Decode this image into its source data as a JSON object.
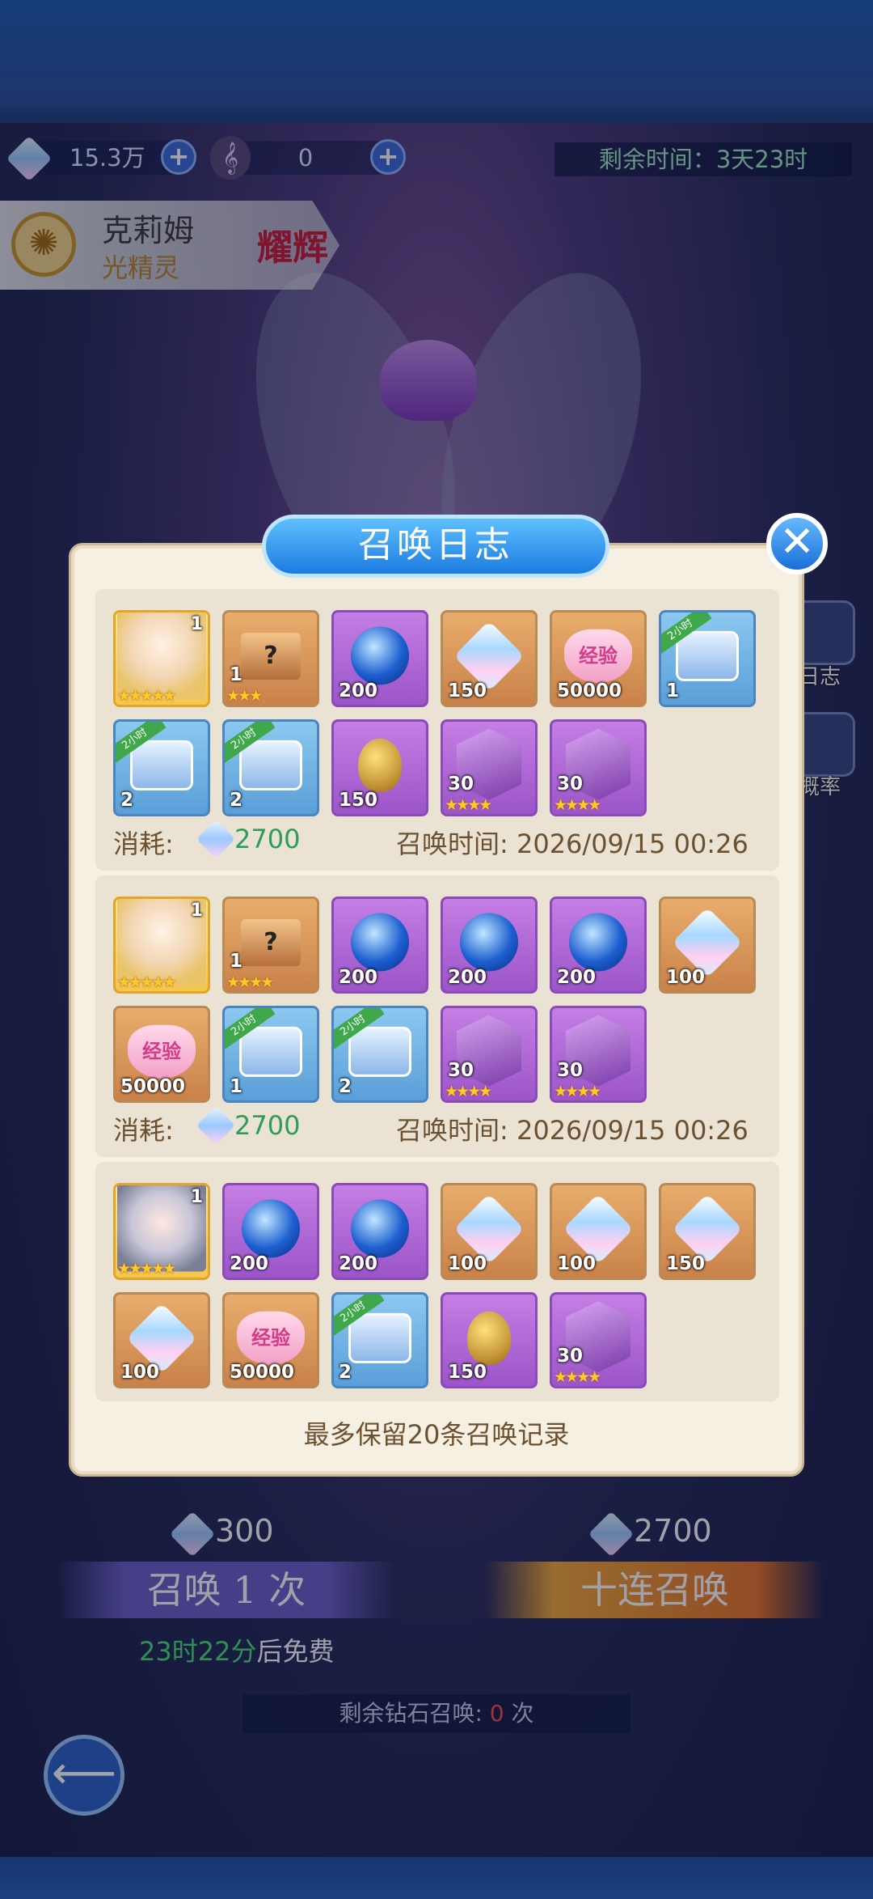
{
  "header": {
    "diamonds": "15.3万",
    "tickets": "0",
    "time_remaining": "剩余时间：3天23时"
  },
  "hero": {
    "name": "克莉姆",
    "title": "光精灵",
    "badge": "耀辉"
  },
  "side": {
    "log_label": "日志",
    "rate_label": "概率"
  },
  "modal": {
    "title": "召唤日志",
    "footer_note": "最多保留20条召唤记录",
    "records": [
      {
        "cost_label": "消耗:",
        "cost": "2700",
        "time_label": "召唤时间:",
        "time": "2026/09/15 00:26",
        "items": [
          {
            "kind": "hero-elf",
            "qty": "1",
            "stars": "★★★★★"
          },
          {
            "kind": "mystery-box",
            "qty": "1",
            "stars": "★★★"
          },
          {
            "kind": "orb",
            "qty": "200"
          },
          {
            "kind": "gem",
            "qty": "150"
          },
          {
            "kind": "exp-heart",
            "qty": "50000",
            "text": "经验"
          },
          {
            "kind": "chest",
            "qty": "1",
            "ribbon": "2小时"
          },
          {
            "kind": "chest-gold",
            "qty": "2",
            "ribbon": "2小时"
          },
          {
            "kind": "chest-gold",
            "qty": "2",
            "ribbon": "2小时"
          },
          {
            "kind": "egg",
            "qty": "150"
          },
          {
            "kind": "cube",
            "qty": "30",
            "stars": "★★★★"
          },
          {
            "kind": "cube",
            "qty": "30",
            "stars": "★★★★"
          }
        ]
      },
      {
        "cost_label": "消耗:",
        "cost": "2700",
        "time_label": "召唤时间:",
        "time": "2026/09/15 00:26",
        "items": [
          {
            "kind": "hero-elf",
            "qty": "1",
            "stars": "★★★★★"
          },
          {
            "kind": "mystery-box",
            "qty": "1",
            "stars": "★★★★"
          },
          {
            "kind": "orb",
            "qty": "200"
          },
          {
            "kind": "orb",
            "qty": "200"
          },
          {
            "kind": "orb",
            "qty": "200"
          },
          {
            "kind": "gem",
            "qty": "100"
          },
          {
            "kind": "exp-heart",
            "qty": "50000",
            "text": "经验"
          },
          {
            "kind": "chest",
            "qty": "1",
            "ribbon": "2小时"
          },
          {
            "kind": "chest-gold",
            "qty": "2",
            "ribbon": "2小时"
          },
          {
            "kind": "cube",
            "qty": "30",
            "stars": "★★★★"
          },
          {
            "kind": "cube",
            "qty": "30",
            "stars": "★★★★"
          }
        ]
      },
      {
        "items": [
          {
            "kind": "hero-girl",
            "qty": "1",
            "stars": "★★★★★"
          },
          {
            "kind": "orb",
            "qty": "200"
          },
          {
            "kind": "orb",
            "qty": "200"
          },
          {
            "kind": "gem",
            "qty": "100"
          },
          {
            "kind": "gem",
            "qty": "100"
          },
          {
            "kind": "gem",
            "qty": "150"
          },
          {
            "kind": "gem",
            "qty": "100"
          },
          {
            "kind": "exp-heart",
            "qty": "50000",
            "text": "经验"
          },
          {
            "kind": "chest-gold",
            "qty": "2",
            "ribbon": "2小时"
          },
          {
            "kind": "egg",
            "qty": "150"
          },
          {
            "kind": "cube",
            "qty": "30",
            "stars": "★★★★"
          }
        ]
      }
    ]
  },
  "summon": {
    "single_cost": "300",
    "ten_cost": "2700",
    "single_label": "召唤 1 次",
    "ten_label": "十连召唤",
    "free_time": "23时22分",
    "free_suffix": "后免费",
    "remaining_label": "剩余钻石召唤:",
    "remaining_count": "0",
    "remaining_unit": "次"
  },
  "colors": {
    "modal_bg": "#f6f0e3",
    "accent_blue": "#1c7ce0",
    "cost_green": "#2f9d5a",
    "text_brown": "#6b5130"
  }
}
